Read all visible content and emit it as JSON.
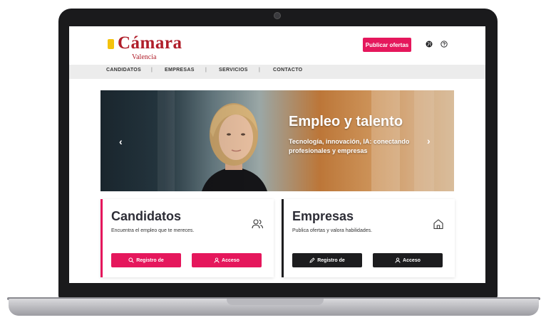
{
  "header": {
    "logo": {
      "main": "Cámara",
      "sub": "Valencia"
    },
    "publish_button": "Publicar ofertas",
    "icons": [
      "globe-icon",
      "help-icon"
    ]
  },
  "nav": {
    "items": [
      {
        "label": "CANDIDATOS"
      },
      {
        "label": "EMPRESAS"
      },
      {
        "label": "SERVICIOS"
      },
      {
        "label": "CONTACTO"
      }
    ],
    "separator": "|"
  },
  "hero": {
    "title": "Empleo y talento",
    "subtitle": "Tecnología, innovación, IA: conectando profesionales y empresas",
    "prev_icon": "‹",
    "next_icon": "›"
  },
  "cards": {
    "candidatos": {
      "title": "Candidatos",
      "description": "Encuentra el empleo que te mereces.",
      "icon": "users-icon",
      "register_button": "Registro de",
      "access_button": "Acceso"
    },
    "empresas": {
      "title": "Empresas",
      "description": "Publica ofertas y valora habilidades.",
      "icon": "home-icon",
      "register_button": "Registro de",
      "access_button": "Acceso"
    }
  },
  "colors": {
    "accent": "#e5175c",
    "brand": "#b01e2a",
    "dark": "#1d1d1f"
  }
}
